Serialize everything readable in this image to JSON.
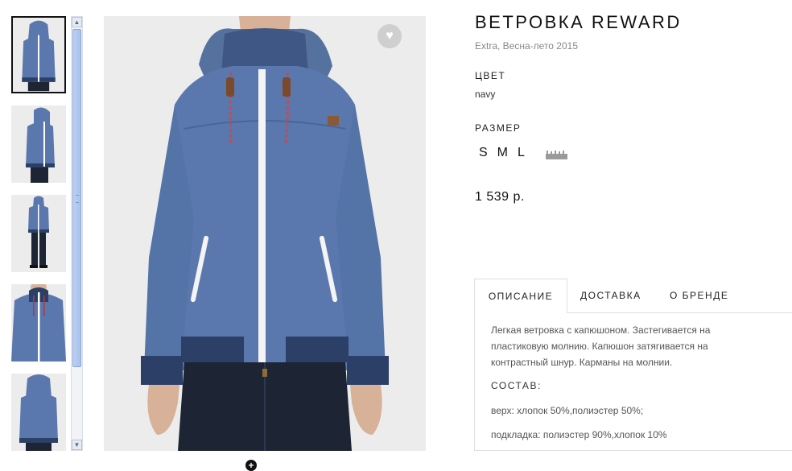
{
  "gallery": {
    "thumbnails": [
      {
        "view": "front",
        "active": true
      },
      {
        "view": "side",
        "active": false
      },
      {
        "view": "full-body",
        "active": false
      },
      {
        "view": "detail",
        "active": false
      },
      {
        "view": "back",
        "active": false
      }
    ],
    "favorite_icon": "heart-icon",
    "favorite_glyph": "♥",
    "zoom_icon": "zoom-plus-icon",
    "zoom_glyph": "+"
  },
  "product": {
    "title": "ВЕТРОВКА REWARD",
    "subtitle": "Extra, Весна-лето 2015",
    "color_label": "ЦВЕТ",
    "color_value": "navy",
    "size_label": "РАЗМЕР",
    "sizes": [
      "S",
      "M",
      "L"
    ],
    "size_chart_icon": "ruler-icon",
    "price": "1 539 р."
  },
  "tabs": {
    "items": [
      "ОПИСАНИЕ",
      "ДОСТАВКА",
      "О БРЕНДЕ"
    ],
    "active": "ОПИСАНИЕ"
  },
  "description": {
    "text": "Легкая ветровка с капюшоном. Застегивается на пластиковую молнию. Капюшон затягивается на контрастный шнур. Карманы на молнии.",
    "composition_label": "СОСТАВ:",
    "composition": [
      "верх: хлопок 50%,полиэстер 50%;",
      "подкладка: полиэстер 90%,хлопок 10%"
    ]
  },
  "colors": {
    "jacket": "#5a78ad",
    "cuff": "#2c3f66",
    "zipper": "#f4f4f4",
    "background": "#ececec"
  }
}
